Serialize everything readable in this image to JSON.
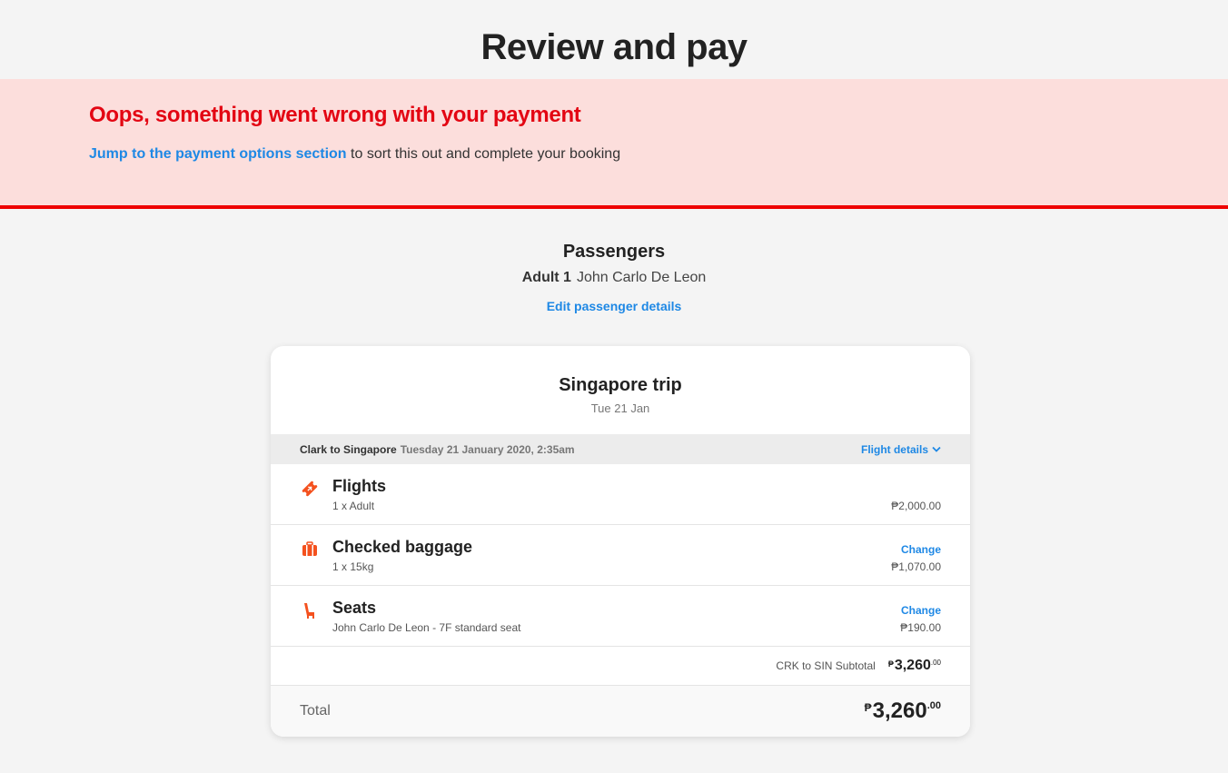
{
  "page": {
    "title": "Review and pay"
  },
  "error": {
    "title": "Oops, something went wrong with your payment",
    "link": "Jump to the payment options section",
    "message": " to sort this out and complete your booking",
    "color": "#e30613",
    "background": "#fcdedc"
  },
  "passengers": {
    "heading": "Passengers",
    "adult_label": "Adult 1",
    "name": "John Carlo De Leon",
    "edit_label": "Edit passenger details"
  },
  "trip": {
    "title": "Singapore trip",
    "date": "Tue 21 Jan",
    "route": "Clark to Singapore",
    "departure": "Tuesday 21 January 2020, 2:35am",
    "flight_details_label": "Flight details",
    "items": [
      {
        "icon": "ticket-icon",
        "title": "Flights",
        "sub": "1 x Adult",
        "change": "",
        "price": "₱2,000.00"
      },
      {
        "icon": "baggage-icon",
        "title": "Checked baggage",
        "sub": "1 x 15kg",
        "change": "Change",
        "price": "₱1,070.00"
      },
      {
        "icon": "seat-icon",
        "title": "Seats",
        "sub": "John Carlo De Leon - 7F standard seat",
        "change": "Change",
        "price": "₱190.00"
      }
    ],
    "subtotal": {
      "label": "CRK to SIN Subtotal",
      "currency": "₱",
      "amount": "3,260",
      "cents": ".00"
    },
    "total": {
      "label": "Total",
      "currency": "₱",
      "amount": "3,260",
      "cents": ".00"
    }
  },
  "colors": {
    "accent": "#1e88e5",
    "icon": "#f4511e",
    "error_border": "#ee0000"
  }
}
